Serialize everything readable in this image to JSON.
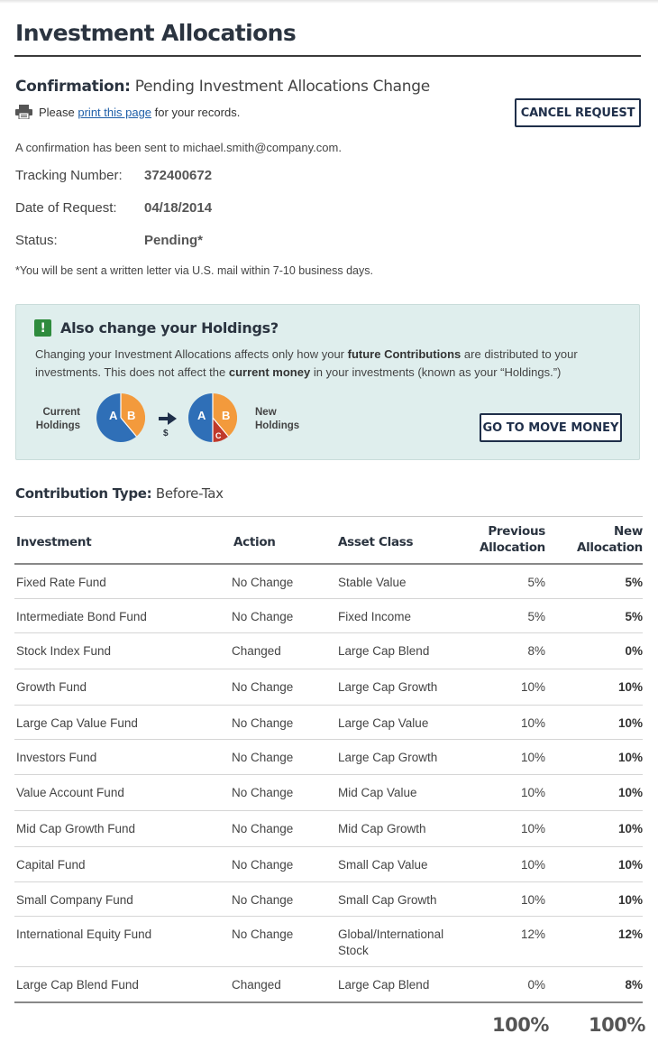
{
  "page": {
    "title": "Investment Allocations"
  },
  "confirmation": {
    "label": "Confirmation:",
    "text": "Pending Investment Allocations Change",
    "print_prefix": "Please",
    "print_link": "print this page",
    "print_suffix": "for your records.",
    "cancel_label": "CANCEL REQUEST",
    "sent_note": "A confirmation has been sent to michael.smith@company.com.",
    "tracking_label": "Tracking Number:",
    "tracking_value": "372400672",
    "date_label": "Date of Request:",
    "date_value": "04/18/2014",
    "status_label": "Status:",
    "status_value": "Pending*",
    "footnote": "*You will be sent a written letter via U.S. mail within 7-10 business days."
  },
  "callout": {
    "icon": "!",
    "title": "Also change your Holdings?",
    "text_1": "Changing your Investment Allocations affects only how your",
    "text_bold_1": "future Contributions",
    "text_2": "are distributed to your investments. This does not affect the",
    "text_bold_2": "current money",
    "text_3": "in your investments (known as your “Holdings.”)",
    "current_label_1": "Current",
    "current_label_2": "Holdings",
    "new_label_1": "New",
    "new_label_2": "Holdings",
    "slice_a": "A",
    "slice_b": "B",
    "slice_c": "C",
    "dollar": "$",
    "button_label": "GO TO MOVE MONEY",
    "colors": {
      "a": "#2f6fb7",
      "b": "#f39a3c",
      "c": "#c0392b"
    }
  },
  "contribution": {
    "label": "Contribution Type:",
    "value": "Before-Tax"
  },
  "table": {
    "headers": {
      "investment": "Investment",
      "action": "Action",
      "asset_class": "Asset Class",
      "previous_1": "Previous",
      "previous_2": "Allocation",
      "new_1": "New",
      "new_2": "Allocation"
    },
    "rows": [
      {
        "investment": "Fixed Rate Fund",
        "action": "No Change",
        "asset_class": "Stable Value",
        "previous": "5%",
        "new": "5%"
      },
      {
        "investment": "Intermediate Bond Fund",
        "action": "No Change",
        "asset_class": "Fixed Income",
        "previous": "5%",
        "new": "5%"
      },
      {
        "investment": "Stock Index Fund",
        "action": "Changed",
        "asset_class": "Large Cap Blend",
        "previous": "8%",
        "new": "0%"
      },
      {
        "investment": "Growth Fund",
        "action": "No Change",
        "asset_class": "Large Cap Growth",
        "previous": "10%",
        "new": "10%"
      },
      {
        "investment": "Large Cap Value Fund",
        "action": "No Change",
        "asset_class": "Large Cap Value",
        "previous": "10%",
        "new": "10%"
      },
      {
        "investment": "Investors Fund",
        "action": "No Change",
        "asset_class": "Large Cap Growth",
        "previous": "10%",
        "new": "10%"
      },
      {
        "investment": "Value Account Fund",
        "action": "No Change",
        "asset_class": "Mid Cap Value",
        "previous": "10%",
        "new": "10%"
      },
      {
        "investment": "Mid Cap Growth Fund",
        "action": "No Change",
        "asset_class": "Mid Cap Growth",
        "previous": "10%",
        "new": "10%"
      },
      {
        "investment": "Capital Fund",
        "action": "No Change",
        "asset_class": "Small Cap Value",
        "previous": "10%",
        "new": "10%"
      },
      {
        "investment": "Small Company Fund",
        "action": "No Change",
        "asset_class": "Small Cap Growth",
        "previous": "10%",
        "new": "10%"
      },
      {
        "investment": "International Equity Fund",
        "action": "No Change",
        "asset_class": "Global/International Stock",
        "previous": "12%",
        "new": "12%"
      },
      {
        "investment": "Large Cap Blend Fund",
        "action": "Changed",
        "asset_class": "Large Cap Blend",
        "previous": "0%",
        "new": "8%"
      }
    ],
    "total_previous": "100%",
    "total_new": "100%"
  }
}
